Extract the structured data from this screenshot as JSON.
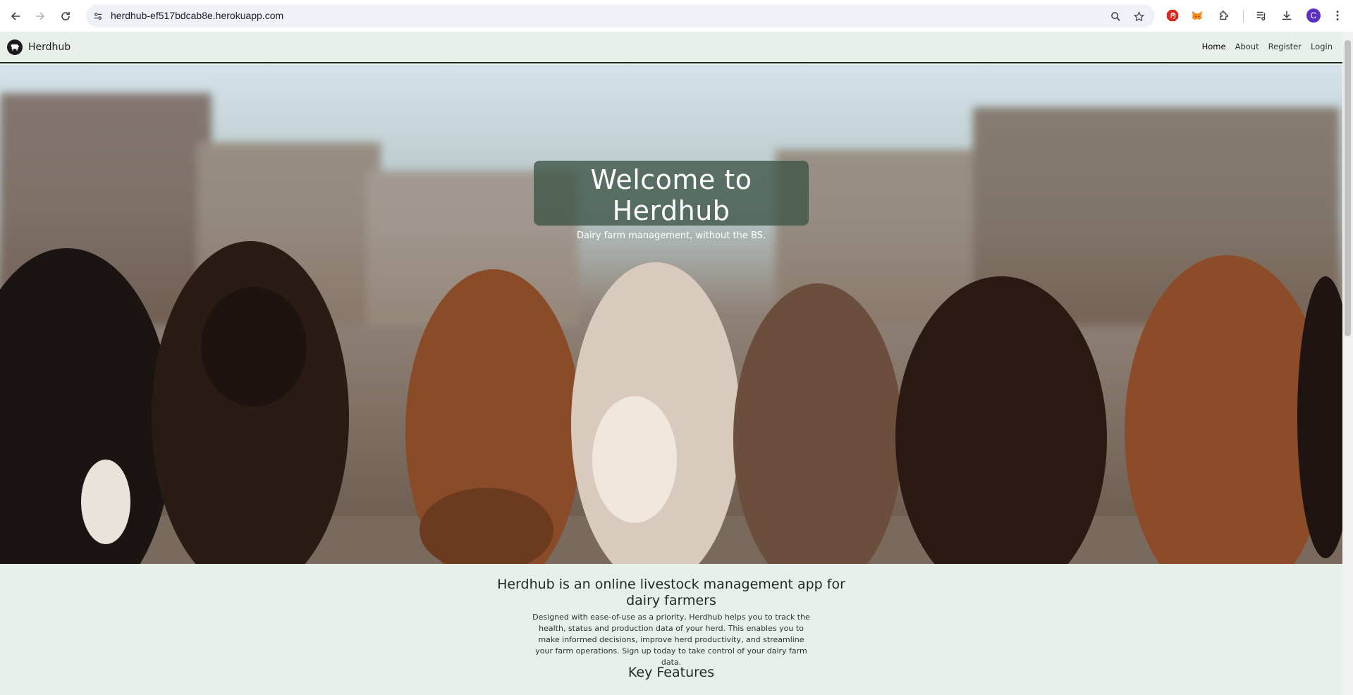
{
  "browser": {
    "url": "herdhub-ef517bdcab8e.herokuapp.com",
    "profile_initial": "C"
  },
  "site": {
    "brand": "Herdhub",
    "nav": [
      {
        "label": "Home",
        "active": true
      },
      {
        "label": "About",
        "active": false
      },
      {
        "label": "Register",
        "active": false
      },
      {
        "label": "Login",
        "active": false
      }
    ]
  },
  "hero": {
    "title": "Welcome to Herdhub",
    "subtitle": "Dairy farm management, without the BS."
  },
  "intro": {
    "title": "Herdhub is an online livestock management app for dairy farmers",
    "body": "Designed with ease-of-use as a priority, Herdhub helps you to track the health, status and production data of your herd. This enables you to make informed decisions, improve herd productivity, and streamline your farm operations. Sign up today to take control of your dairy farm data.",
    "features_title": "Key Features"
  },
  "icons": {
    "back": "back-arrow-icon",
    "forward": "forward-arrow-icon",
    "reload": "reload-icon",
    "site_info": "site-info-icon",
    "zoom": "zoom-icon",
    "bookmark": "star-icon",
    "extensions": [
      "adblock-icon",
      "metamask-fox-icon",
      "puzzle-extensions-icon",
      "reading-list-icon",
      "download-icon",
      "kebab-menu-icon"
    ]
  },
  "colors": {
    "page_bg": "#e8efe8",
    "hero_card": "#3c5446",
    "text_dark": "#1e2a22"
  }
}
